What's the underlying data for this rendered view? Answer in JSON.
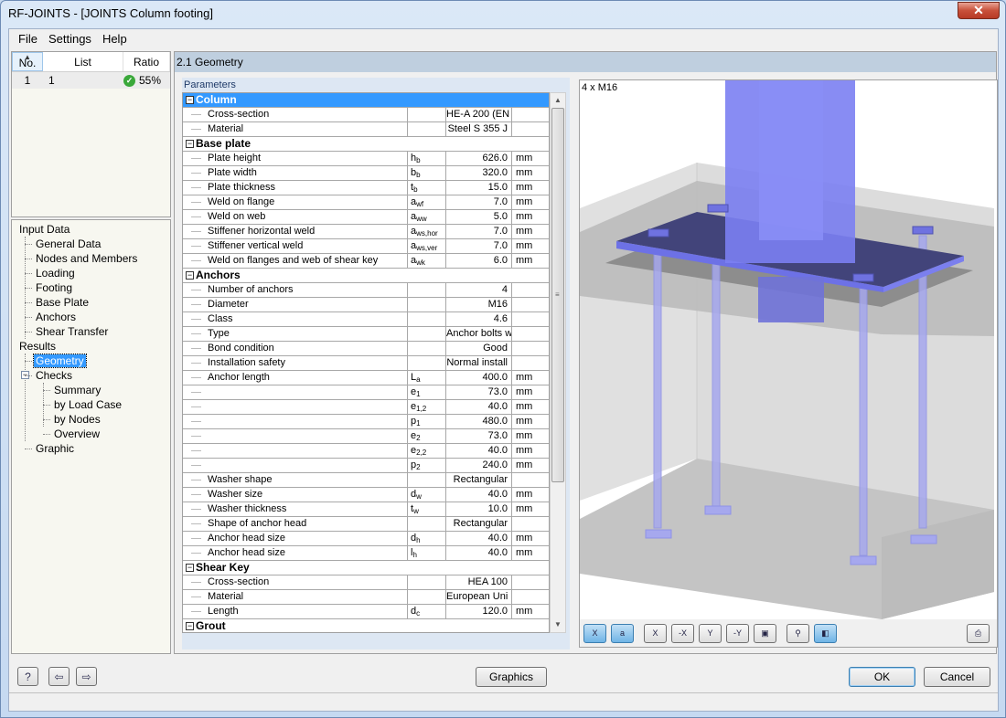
{
  "window": {
    "title": "RF-JOINTS - [JOINTS Column footing]",
    "close_icon": "close-icon"
  },
  "menu": [
    "File",
    "Settings",
    "Help"
  ],
  "case_list": {
    "headers": {
      "no": "No.",
      "list": "List",
      "ratio": "Ratio"
    },
    "rows": [
      {
        "no": "1",
        "list": "1",
        "ratio": "55%",
        "status": "ok"
      }
    ]
  },
  "nav": {
    "input_data": "Input Data",
    "input_items": [
      "General Data",
      "Nodes and Members",
      "Loading",
      "Footing",
      "Base Plate",
      "Anchors",
      "Shear Transfer"
    ],
    "results": "Results",
    "geometry": "Geometry",
    "checks": "Checks",
    "check_items": [
      "Summary",
      "by Load Case",
      "by Nodes",
      "Overview"
    ],
    "graphic": "Graphic"
  },
  "section_title": "2.1 Geometry",
  "params_label": "Parameters",
  "params": [
    {
      "type": "group",
      "label": "Column",
      "selected": true
    },
    {
      "type": "row",
      "name": "Cross-section",
      "sym": "",
      "sub": "",
      "value": "HE-A 200 (EN",
      "unit": ""
    },
    {
      "type": "row",
      "name": "Material",
      "sym": "",
      "sub": "",
      "value": "Steel S 355 J",
      "unit": ""
    },
    {
      "type": "group",
      "label": "Base plate"
    },
    {
      "type": "row",
      "name": "Plate height",
      "sym": "h",
      "sub": "b",
      "value": "626.0",
      "unit": "mm"
    },
    {
      "type": "row",
      "name": "Plate width",
      "sym": "b",
      "sub": "b",
      "value": "320.0",
      "unit": "mm"
    },
    {
      "type": "row",
      "name": "Plate thickness",
      "sym": "t",
      "sub": "b",
      "value": "15.0",
      "unit": "mm"
    },
    {
      "type": "row",
      "name": "Weld on flange",
      "sym": "a",
      "sub": "wf",
      "value": "7.0",
      "unit": "mm"
    },
    {
      "type": "row",
      "name": "Weld on web",
      "sym": "a",
      "sub": "ww",
      "value": "5.0",
      "unit": "mm"
    },
    {
      "type": "row",
      "name": "Stiffener horizontal weld",
      "sym": "a",
      "sub": "ws,hor",
      "value": "7.0",
      "unit": "mm"
    },
    {
      "type": "row",
      "name": "Stiffener vertical weld",
      "sym": "a",
      "sub": "ws,ver",
      "value": "7.0",
      "unit": "mm"
    },
    {
      "type": "row",
      "name": "Weld on flanges and web of shear key",
      "sym": "a",
      "sub": "wk",
      "value": "6.0",
      "unit": "mm"
    },
    {
      "type": "group",
      "label": "Anchors"
    },
    {
      "type": "row",
      "name": "Number of anchors",
      "sym": "",
      "sub": "",
      "value": "4",
      "unit": ""
    },
    {
      "type": "row",
      "name": "Diameter",
      "sym": "",
      "sub": "",
      "value": "M16",
      "unit": ""
    },
    {
      "type": "row",
      "name": "Class",
      "sym": "",
      "sub": "",
      "value": "4.6",
      "unit": ""
    },
    {
      "type": "row",
      "name": "Type",
      "sym": "",
      "sub": "",
      "value": "Anchor bolts w",
      "unit": ""
    },
    {
      "type": "row",
      "name": "Bond condition",
      "sym": "",
      "sub": "",
      "value": "Good",
      "unit": ""
    },
    {
      "type": "row",
      "name": "Installation safety",
      "sym": "",
      "sub": "",
      "value": "Normal install",
      "unit": ""
    },
    {
      "type": "row",
      "name": "Anchor length",
      "sym": "L",
      "sub": "a",
      "value": "400.0",
      "unit": "mm"
    },
    {
      "type": "row",
      "name": "",
      "sym": "e",
      "sub": "1",
      "value": "73.0",
      "unit": "mm"
    },
    {
      "type": "row",
      "name": "",
      "sym": "e",
      "sub": "1,2",
      "value": "40.0",
      "unit": "mm"
    },
    {
      "type": "row",
      "name": "",
      "sym": "p",
      "sub": "1",
      "value": "480.0",
      "unit": "mm"
    },
    {
      "type": "row",
      "name": "",
      "sym": "e",
      "sub": "2",
      "value": "73.0",
      "unit": "mm"
    },
    {
      "type": "row",
      "name": "",
      "sym": "e",
      "sub": "2,2",
      "value": "40.0",
      "unit": "mm"
    },
    {
      "type": "row",
      "name": "",
      "sym": "p",
      "sub": "2",
      "value": "240.0",
      "unit": "mm"
    },
    {
      "type": "row",
      "name": "Washer shape",
      "sym": "",
      "sub": "",
      "value": "Rectangular",
      "unit": ""
    },
    {
      "type": "row",
      "name": "Washer size",
      "sym": "d",
      "sub": "w",
      "value": "40.0",
      "unit": "mm"
    },
    {
      "type": "row",
      "name": "Washer thickness",
      "sym": "t",
      "sub": "w",
      "value": "10.0",
      "unit": "mm"
    },
    {
      "type": "row",
      "name": "Shape of anchor head",
      "sym": "",
      "sub": "",
      "value": "Rectangular",
      "unit": ""
    },
    {
      "type": "row",
      "name": "Anchor head size",
      "sym": "d",
      "sub": "h",
      "value": "40.0",
      "unit": "mm"
    },
    {
      "type": "row",
      "name": "Anchor head size",
      "sym": "l",
      "sub": "h",
      "value": "40.0",
      "unit": "mm"
    },
    {
      "type": "group",
      "label": "Shear Key"
    },
    {
      "type": "row",
      "name": "Cross-section",
      "sym": "",
      "sub": "",
      "value": "HEA 100",
      "unit": ""
    },
    {
      "type": "row",
      "name": "Material",
      "sym": "",
      "sub": "",
      "value": "European Uni",
      "unit": ""
    },
    {
      "type": "row",
      "name": "Length",
      "sym": "d",
      "sub": "c",
      "value": "120.0",
      "unit": "mm"
    },
    {
      "type": "group",
      "label": "Grout"
    }
  ],
  "graphic": {
    "label": "4 x M16",
    "toolbar": [
      {
        "name": "view-x-icon",
        "glyph": "X",
        "active": true
      },
      {
        "name": "view-a-icon",
        "glyph": "a",
        "active": true
      },
      {
        "name": "view-plus-x-icon",
        "glyph": "X"
      },
      {
        "name": "view-minus-x-icon",
        "glyph": "-X"
      },
      {
        "name": "view-plus-y-icon",
        "glyph": "Y"
      },
      {
        "name": "view-minus-y-icon",
        "glyph": "-Y"
      },
      {
        "name": "isometric-view-icon",
        "glyph": "▣"
      },
      {
        "name": "zoom-reset-icon",
        "glyph": "⚲"
      },
      {
        "name": "transparency-icon",
        "glyph": "◧",
        "active": true
      }
    ],
    "colors": {
      "steel": "#7b7ff2",
      "concrete_top": "#b8b8b8",
      "concrete_side": "#d6d6d6"
    }
  },
  "buttons": {
    "graphics": "Graphics",
    "ok": "OK",
    "cancel": "Cancel"
  }
}
